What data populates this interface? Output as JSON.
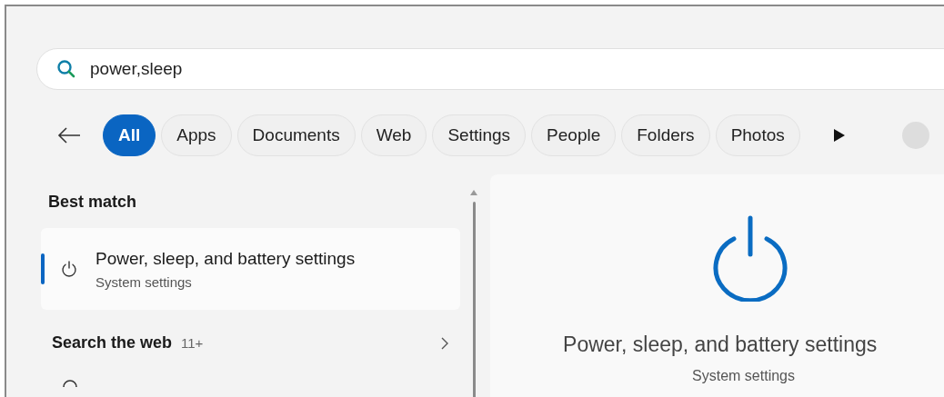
{
  "search": {
    "value": "power,sleep"
  },
  "filters": [
    {
      "label": "All",
      "selected": true
    },
    {
      "label": "Apps",
      "selected": false
    },
    {
      "label": "Documents",
      "selected": false
    },
    {
      "label": "Web",
      "selected": false
    },
    {
      "label": "Settings",
      "selected": false
    },
    {
      "label": "People",
      "selected": false
    },
    {
      "label": "Folders",
      "selected": false
    },
    {
      "label": "Photos",
      "selected": false
    }
  ],
  "best_match": {
    "heading": "Best match",
    "items": [
      {
        "title": "Power, sleep, and battery settings",
        "subtitle": "System settings",
        "selected": true
      }
    ]
  },
  "web_section": {
    "heading": "Search the web",
    "count": "11+"
  },
  "preview": {
    "title": "Power, sleep, and battery settings",
    "subtitle": "System settings"
  }
}
